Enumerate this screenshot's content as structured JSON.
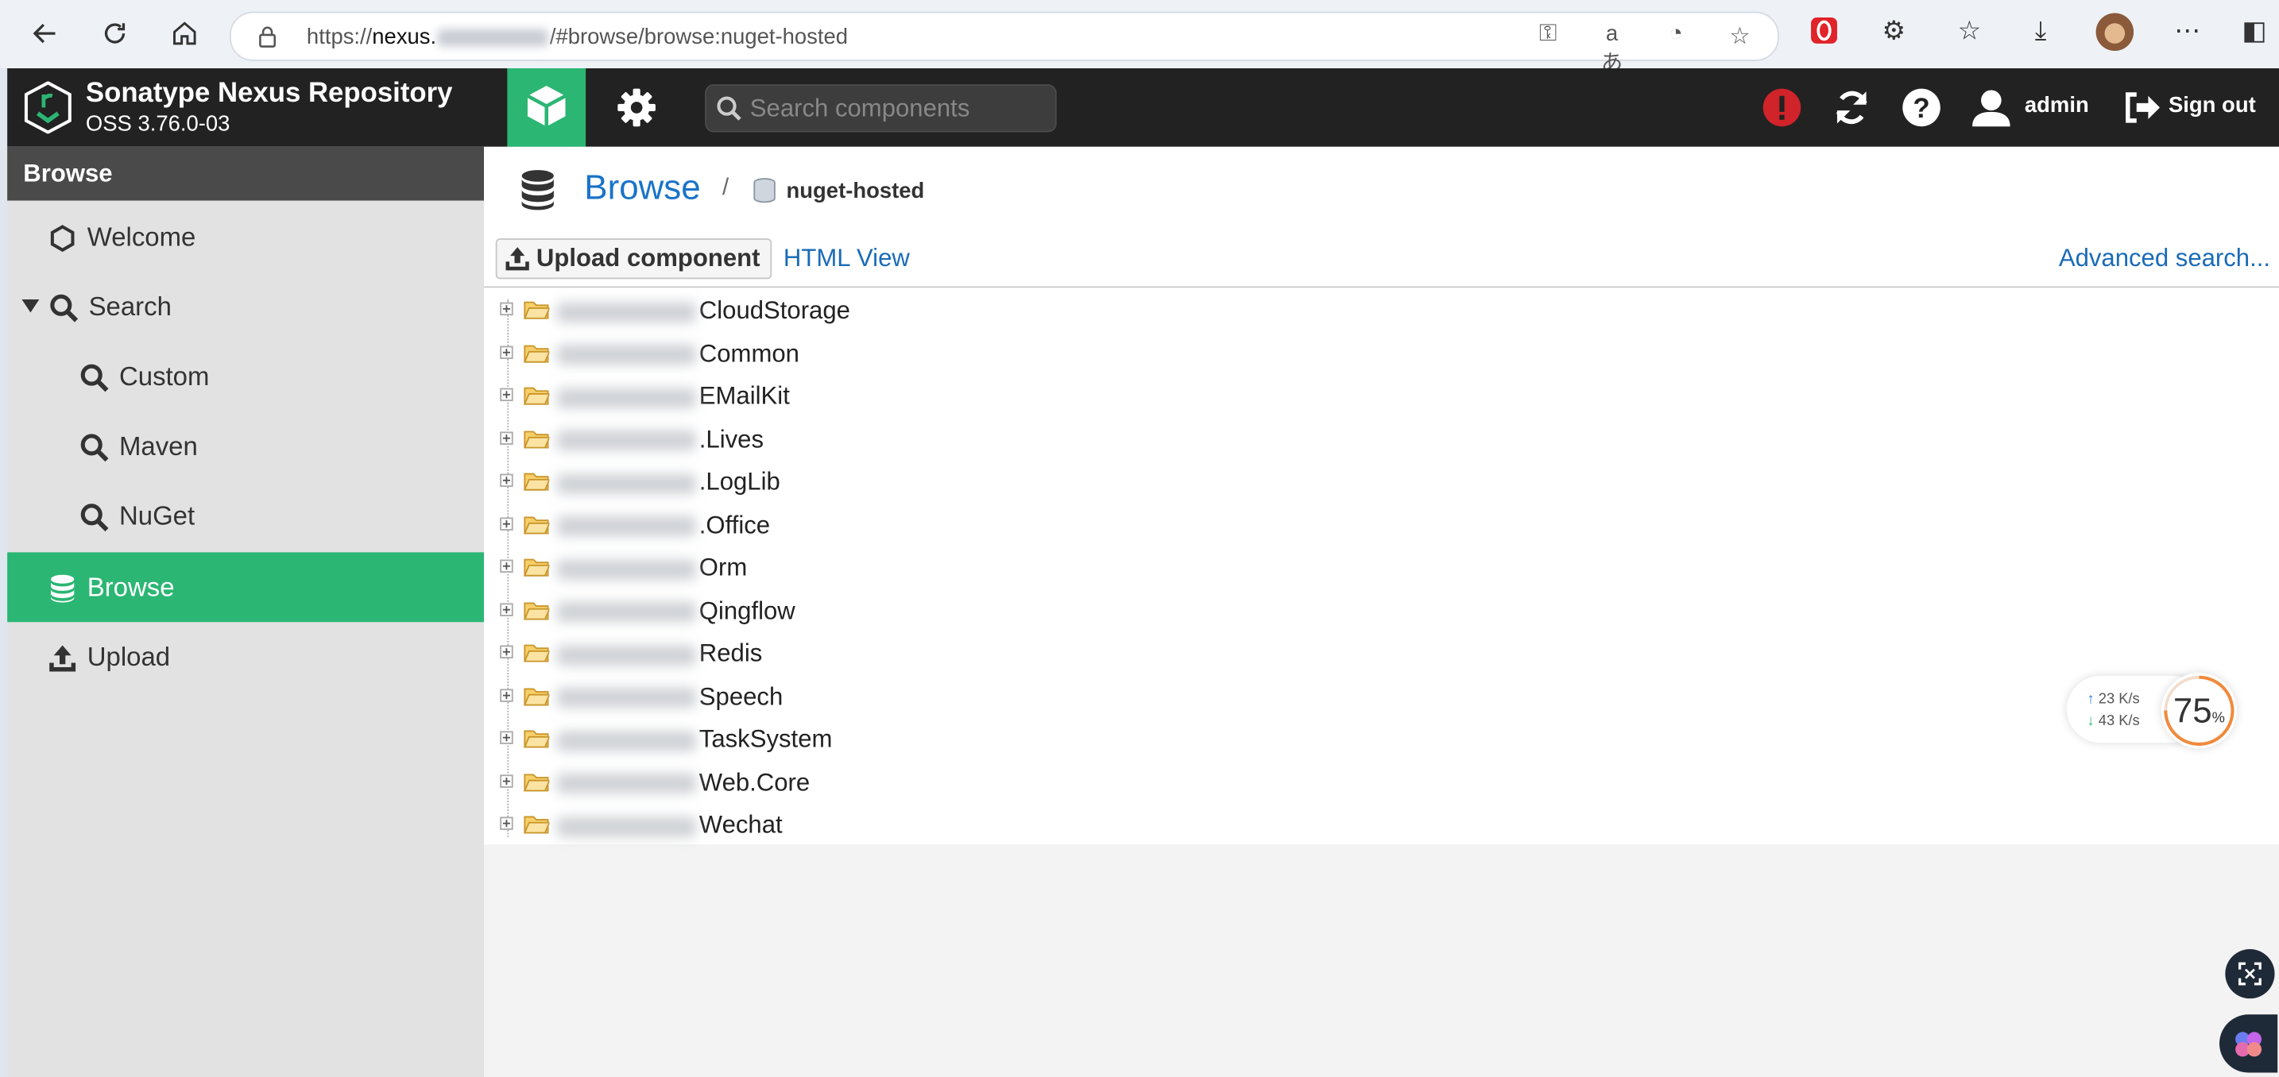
{
  "browser": {
    "url_prefix": "https://",
    "url_host": "nexus.",
    "url_rest": "/#browse/browse:nuget-hosted"
  },
  "header": {
    "product_name": "Sonatype Nexus Repository",
    "version": "OSS 3.76.0-03",
    "search_placeholder": "Search components",
    "user": "admin",
    "sign_out": "Sign out"
  },
  "sidebar": {
    "title": "Browse",
    "items": [
      {
        "label": "Welcome",
        "icon": "hexagon-icon",
        "level": 0
      },
      {
        "label": "Search",
        "icon": "search-icon",
        "level": 0,
        "expanded": true
      },
      {
        "label": "Custom",
        "icon": "search-icon",
        "level": 1
      },
      {
        "label": "Maven",
        "icon": "search-icon",
        "level": 1
      },
      {
        "label": "NuGet",
        "icon": "search-icon",
        "level": 1
      },
      {
        "label": "Browse",
        "icon": "database-icon",
        "level": 0,
        "active": true
      },
      {
        "label": "Upload",
        "icon": "upload-icon",
        "level": 0
      }
    ]
  },
  "main": {
    "breadcrumb_title": "Browse",
    "breadcrumb_separator": "/",
    "repository": "nuget-hosted",
    "upload_button": "Upload component",
    "html_view": "HTML View",
    "advanced_search": "Advanced search...",
    "tree_items": [
      "CloudStorage",
      "Common",
      "EMailKit",
      ".Lives",
      ".LogLib",
      ".Office",
      "Orm",
      "Qingflow",
      "Redis",
      "Speech",
      "TaskSystem",
      "Web.Core",
      "Wechat"
    ]
  },
  "widgets": {
    "upload_speed": "23 K/s",
    "download_speed": "43 K/s",
    "percent": "75",
    "percent_unit": "%"
  },
  "colors": {
    "accent_green": "#2bb673",
    "link_blue": "#1a6bb8",
    "header_bg": "#222222"
  }
}
